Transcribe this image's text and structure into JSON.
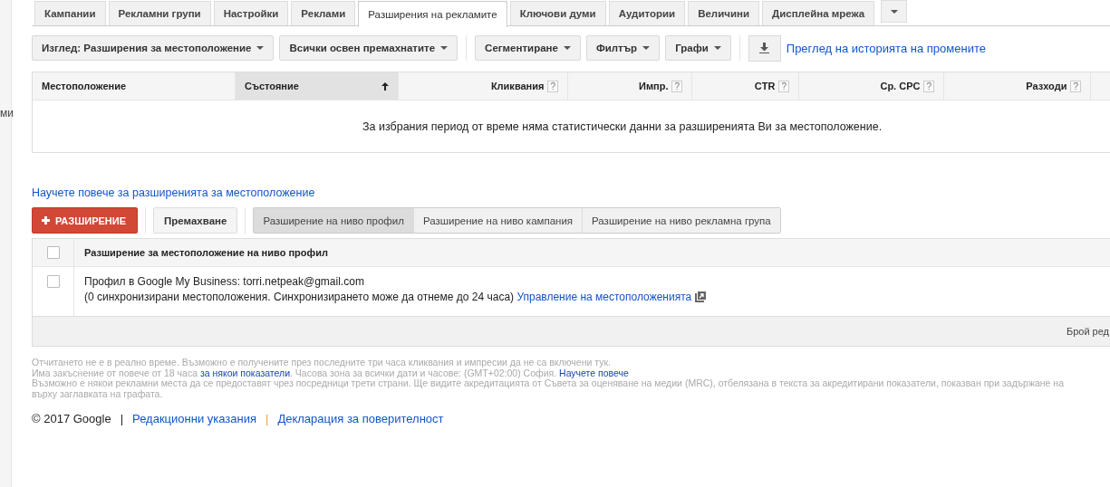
{
  "sidebar": {
    "label_fragment": "ми"
  },
  "tabs": [
    {
      "label": "Кампании",
      "selected": false
    },
    {
      "label": "Рекламни групи",
      "selected": false
    },
    {
      "label": "Настройки",
      "selected": false
    },
    {
      "label": "Реклами",
      "selected": false
    },
    {
      "label": "Разширения на рекламите",
      "selected": true
    },
    {
      "label": "Ключови думи",
      "selected": false
    },
    {
      "label": "Аудитории",
      "selected": false
    },
    {
      "label": "Величини",
      "selected": false
    },
    {
      "label": "Дисплейна мрежа",
      "selected": false
    }
  ],
  "toolbar": {
    "dropdowns": [
      "Изглед: Разширения за местоположение",
      "Всички освен премахнатите",
      "Сегментиране",
      "Филтър",
      "Графи"
    ],
    "history_link": "Преглед на историята на промените"
  },
  "stats_table": {
    "columns": [
      {
        "label": "Местоположение",
        "sorted": false
      },
      {
        "label": "Състояние",
        "sorted": true
      },
      {
        "label": "Кликвания",
        "sorted": false,
        "help": "?"
      },
      {
        "label": "Импр.",
        "sorted": false,
        "help": "?"
      },
      {
        "label": "CTR",
        "sorted": false,
        "help": "?"
      },
      {
        "label": "Ср. CPC",
        "sorted": false,
        "help": "?"
      },
      {
        "label": "Разходи",
        "sorted": false,
        "help": "?"
      }
    ],
    "empty_message": "За избрания период от време няма статистически данни за разширенията Ви за местоположение."
  },
  "learn_more_link": "Научете повече за разширенията за местоположение",
  "actions": {
    "add_button": "РАЗШИРЕНИЕ",
    "remove_button": "Премахване",
    "levels": [
      {
        "label": "Разширение на ниво профил",
        "selected": true
      },
      {
        "label": "Разширение на ниво кампания",
        "selected": false
      },
      {
        "label": "Разширение на ниво рекламна група",
        "selected": false
      }
    ]
  },
  "extensions_table": {
    "header_checked": false,
    "header": "Разширение за местоположение на ниво профил",
    "rows": [
      {
        "checked": false,
        "line_1": "Профил в Google My Business: torri.netpeak@gmail.com",
        "line_2": "(0 синхронизирани местоположения. Синхронизирането може да отнеме до 24 часа)",
        "link": "Управление на местоположенията"
      }
    ],
    "footer": "Брой ред"
  },
  "notes": [
    [
      {
        "kind": "text",
        "text": "Отчитането не е в реално време. Възможно е получените през последните три часа кликвания и импресии да не са включени тук."
      }
    ],
    [
      {
        "kind": "text",
        "text": "Има закъснение от повече от 18 часа "
      },
      {
        "kind": "link",
        "text": "за някои показатели"
      },
      {
        "kind": "text",
        "text": ". Часова зона за всички дати и часове: (GMT+02:00) София. "
      },
      {
        "kind": "link",
        "text": "Научете повече"
      }
    ],
    [
      {
        "kind": "text",
        "text": "Възможно е някои рекламни места да се предоставят чрез посредници трети страни. Ще видите акредитацията от Съвета за оценяване на медии (MRC), отбелязана в текста за акредитирани показатели, показван при задържане на"
      }
    ],
    [
      {
        "kind": "text",
        "text": "върху заглавката на графата."
      }
    ]
  ],
  "footer": {
    "copyright": "© 2017 Google",
    "separators": [
      "|",
      "|"
    ],
    "links": [
      "Редакционни указания",
      "Декларация за поверителност"
    ]
  }
}
